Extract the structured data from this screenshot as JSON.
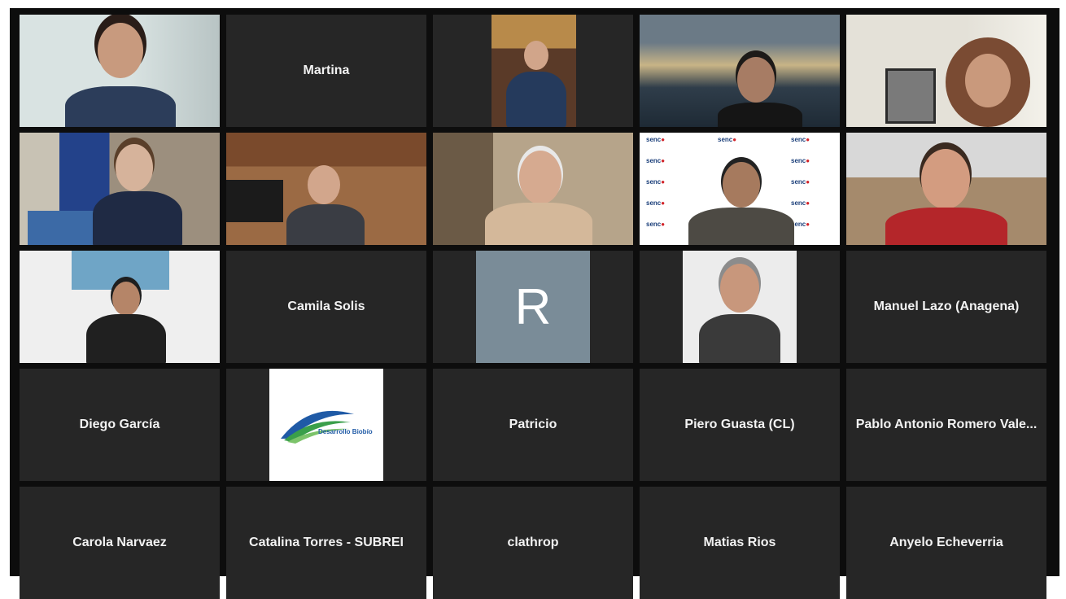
{
  "participants": [
    {
      "name": "",
      "type": "video"
    },
    {
      "name": "Martina",
      "type": "name"
    },
    {
      "name": "",
      "type": "video"
    },
    {
      "name": "",
      "type": "video"
    },
    {
      "name": "",
      "type": "video"
    },
    {
      "name": "",
      "type": "video",
      "active_speaker": true
    },
    {
      "name": "",
      "type": "video"
    },
    {
      "name": "",
      "type": "video"
    },
    {
      "name": "",
      "type": "video"
    },
    {
      "name": "",
      "type": "video"
    },
    {
      "name": "",
      "type": "video"
    },
    {
      "name": "Camila Solis",
      "type": "name"
    },
    {
      "name": "",
      "type": "initial",
      "initial": "R"
    },
    {
      "name": "",
      "type": "video"
    },
    {
      "name": "Manuel Lazo (Anagena)",
      "type": "name"
    },
    {
      "name": "Diego García",
      "type": "name"
    },
    {
      "name": "",
      "type": "logo",
      "logo": "Desarrollo Biobío"
    },
    {
      "name": "Patricio",
      "type": "name"
    },
    {
      "name": "Piero Guasta (CL)",
      "type": "name"
    },
    {
      "name": "Pablo Antonio Romero Vale...",
      "type": "name"
    },
    {
      "name": "Carola Narvaez",
      "type": "name"
    },
    {
      "name": "Catalina Torres - SUBREI",
      "type": "name"
    },
    {
      "name": "clathrop",
      "type": "name"
    },
    {
      "name": "Matias Rios",
      "type": "name"
    },
    {
      "name": "Anyelo Echeverria",
      "type": "name"
    }
  ],
  "accent_color": "#b7d86a",
  "background_color": "#0d0d0d",
  "tile_color": "#262626"
}
